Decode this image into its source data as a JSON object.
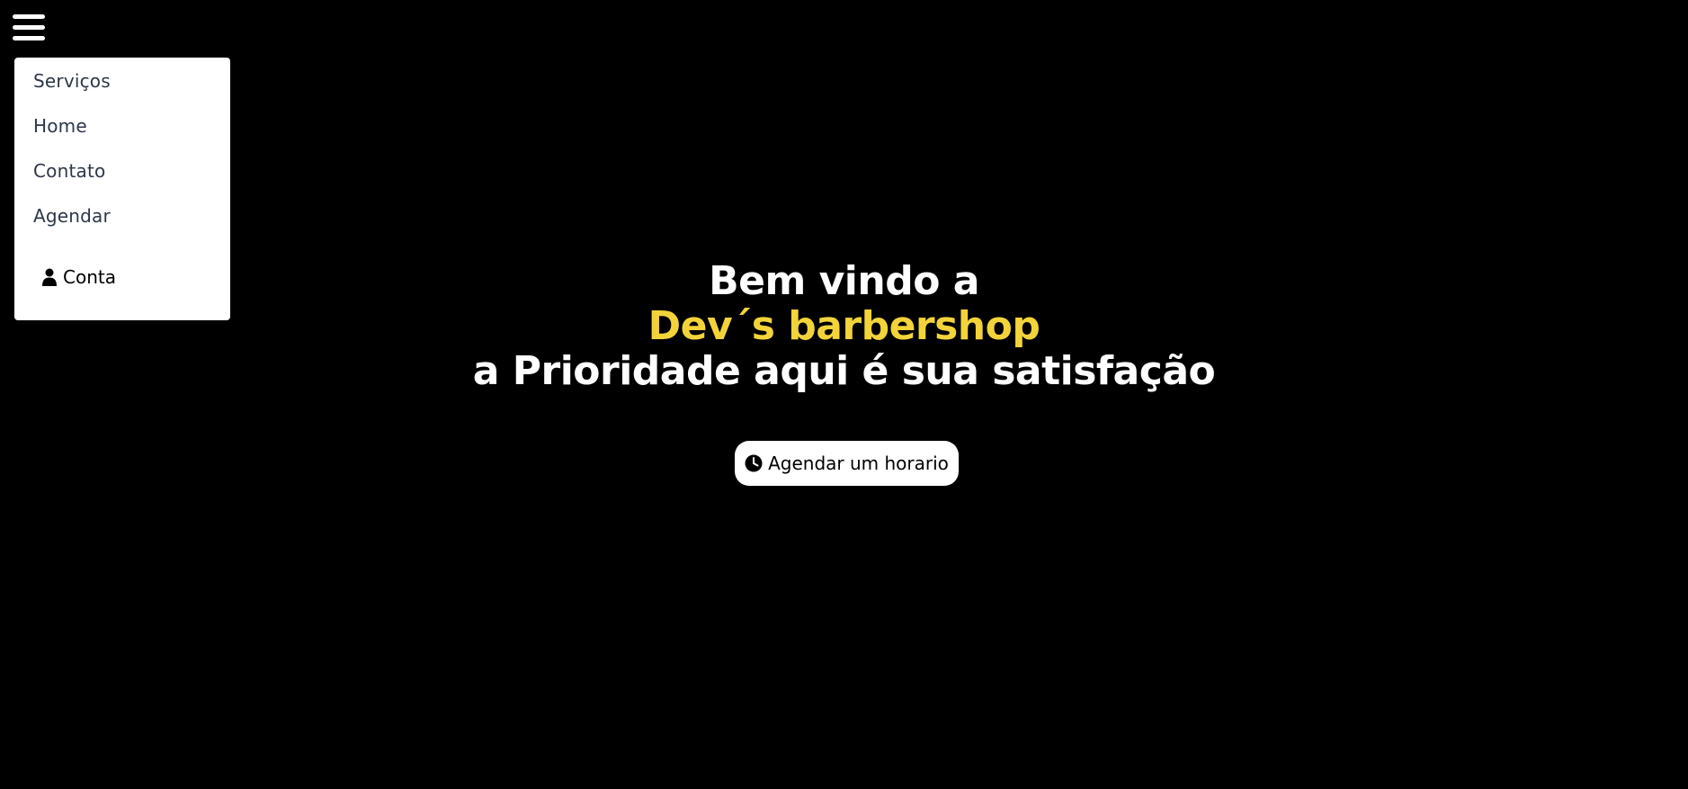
{
  "colors": {
    "background": "#000000",
    "brand_accent": "#f2d43a",
    "menu_background": "#ffffff",
    "menu_text": "#2d3748"
  },
  "nav": {
    "toggle_icon": "hamburger-menu-icon",
    "items": [
      {
        "label": "Serviços"
      },
      {
        "label": "Home"
      },
      {
        "label": "Contato"
      },
      {
        "label": "Agendar"
      }
    ],
    "account": {
      "icon": "user-icon",
      "label": "Conta"
    }
  },
  "hero": {
    "line1": "Bem vindo a",
    "brand": "Dev´s barbershop",
    "line3": "a Prioridade aqui é sua satisfação",
    "cta": {
      "icon": "clock-icon",
      "label": "Agendar um horario"
    }
  }
}
